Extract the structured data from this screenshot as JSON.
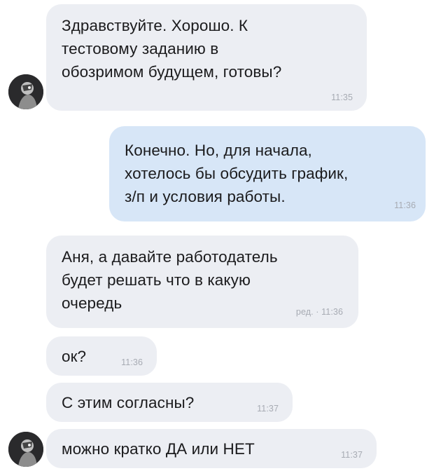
{
  "messages": [
    {
      "id": "msg-1",
      "direction": "incoming",
      "text": "Здравствуйте. Хорошо. К\nтестовому заданию в\nобозримом будущем, готовы?",
      "time": "11:35",
      "edited_label": ""
    },
    {
      "id": "msg-2",
      "direction": "outgoing",
      "text": "Конечно. Но, для начала,\nхотелось бы обсудить график,\nз/п и условия работы.",
      "time": "11:36",
      "edited_label": ""
    },
    {
      "id": "msg-3",
      "direction": "incoming",
      "text": "Аня, а давайте работодатель\nбудет решать что в какую\nочередь",
      "time": "11:36",
      "edited_label": "ред."
    },
    {
      "id": "msg-4",
      "direction": "incoming",
      "text": "ок?",
      "time": "11:36",
      "edited_label": ""
    },
    {
      "id": "msg-5",
      "direction": "incoming",
      "text": "С этим согласны?",
      "time": "11:37",
      "edited_label": ""
    },
    {
      "id": "msg-6",
      "direction": "incoming",
      "text": "можно кратко ДА или НЕТ",
      "time": "11:37",
      "edited_label": ""
    }
  ],
  "meta_separator": " · ",
  "colors": {
    "incoming_bubble": "#eceef3",
    "outgoing_bubble": "#d7e6f7",
    "text": "#1b1b1d",
    "time": "#a7abb3"
  },
  "icons": {
    "avatar": "user-avatar-icon"
  }
}
